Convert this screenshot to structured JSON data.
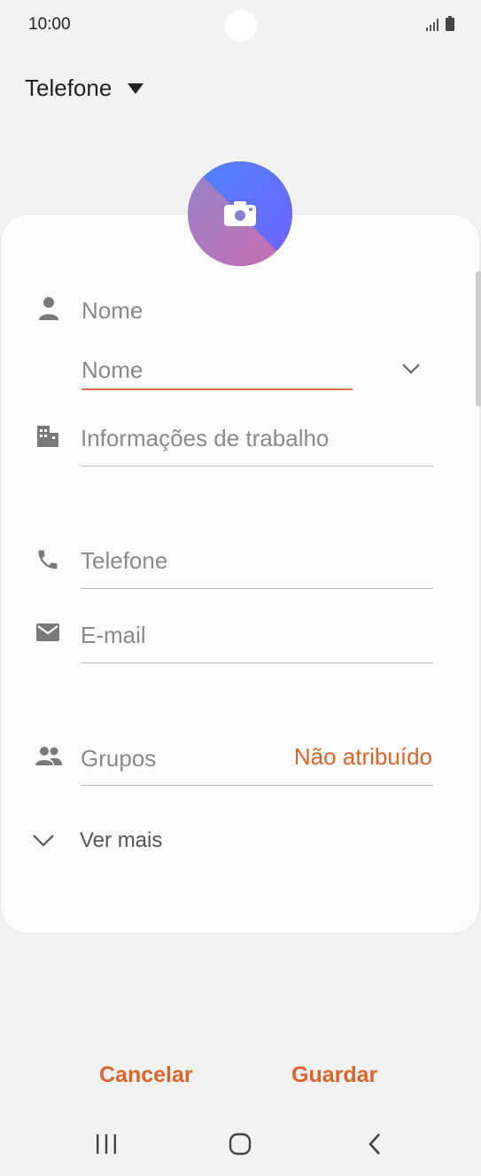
{
  "status": {
    "time": "10:00"
  },
  "account": {
    "label": "Telefone"
  },
  "fields": {
    "name_label": "Nome",
    "name_placeholder": "Nome",
    "work_label": "Informações de trabalho",
    "phone_label": "Telefone",
    "email_label": "E-mail",
    "groups_label": "Grupos",
    "groups_value": "Não atribuído",
    "more_label": "Ver mais"
  },
  "actions": {
    "cancel": "Cancelar",
    "save": "Guardar"
  },
  "colors": {
    "accent": "#d8652d",
    "underline_active": "#e36f3b",
    "background": "#f2f2f2",
    "card": "#fcfcfc"
  },
  "icons": {
    "status": [
      "signal-icon",
      "battery-icon"
    ],
    "account": "dropdown-arrow-icon",
    "photo": "camera-icon",
    "rows": [
      "person-icon",
      "building-icon",
      "phone-icon",
      "email-icon",
      "group-icon"
    ],
    "name_expand": "chevron-down-icon",
    "more": "chevron-down-icon",
    "nav": [
      "recent-apps-icon",
      "home-icon",
      "back-icon"
    ]
  }
}
